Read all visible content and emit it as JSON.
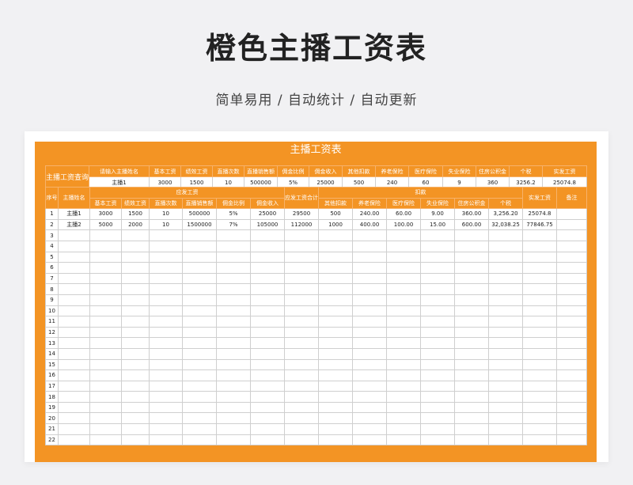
{
  "page": {
    "title": "橙色主播工资表",
    "subtitle": "简单易用 / 自动统计 / 自动更新"
  },
  "sheet": {
    "title": "主播工资表",
    "query": {
      "label": "主播工资查询",
      "headers": [
        "请输入主播姓名",
        "基本工资",
        "绩效工资",
        "直播次数",
        "直播销售额",
        "佣金比例",
        "佣金收入",
        "其他扣款",
        "养老保险",
        "医疗保险",
        "失业保险",
        "住房公积金",
        "个税",
        "实发工资"
      ],
      "values": [
        "主播1",
        "3000",
        "1500",
        "10",
        "500000",
        "5%",
        "25000",
        "500",
        "240",
        "60",
        "9",
        "360",
        "3256.2",
        "25074.8"
      ]
    },
    "header": {
      "seq": "序号",
      "name": "主播姓名",
      "payable_group": "应发工资",
      "payable_subs": [
        "基本工资",
        "绩效工资",
        "直播次数",
        "直播销售额",
        "佣金比例",
        "佣金收入"
      ],
      "payable_total": "应发工资合计",
      "deduct_group": "扣款",
      "deduct_subs": [
        "其他扣款",
        "养老保险",
        "医疗保险",
        "失业保险",
        "住房公积金",
        "个税"
      ],
      "net": "实发工资",
      "remark": "备注"
    },
    "rows": [
      {
        "seq": "1",
        "cells": [
          "主播1",
          "3000",
          "1500",
          "10",
          "500000",
          "5%",
          "25000",
          "29500",
          "500",
          "240.00",
          "60.00",
          "9.00",
          "360.00",
          "3,256.20",
          "25074.8",
          ""
        ]
      },
      {
        "seq": "2",
        "cells": [
          "主播2",
          "5000",
          "2000",
          "10",
          "1500000",
          "7%",
          "105000",
          "112000",
          "1000",
          "400.00",
          "100.00",
          "15.00",
          "600.00",
          "32,038.25",
          "77846.75",
          ""
        ]
      },
      {
        "seq": "3",
        "cells": []
      },
      {
        "seq": "4",
        "cells": []
      },
      {
        "seq": "5",
        "cells": []
      },
      {
        "seq": "6",
        "cells": []
      },
      {
        "seq": "7",
        "cells": []
      },
      {
        "seq": "8",
        "cells": []
      },
      {
        "seq": "9",
        "cells": []
      },
      {
        "seq": "10",
        "cells": []
      },
      {
        "seq": "11",
        "cells": []
      },
      {
        "seq": "12",
        "cells": []
      },
      {
        "seq": "13",
        "cells": []
      },
      {
        "seq": "14",
        "cells": []
      },
      {
        "seq": "15",
        "cells": []
      },
      {
        "seq": "16",
        "cells": []
      },
      {
        "seq": "17",
        "cells": []
      },
      {
        "seq": "18",
        "cells": []
      },
      {
        "seq": "19",
        "cells": []
      },
      {
        "seq": "20",
        "cells": []
      },
      {
        "seq": "21",
        "cells": []
      },
      {
        "seq": "22",
        "cells": []
      }
    ]
  }
}
